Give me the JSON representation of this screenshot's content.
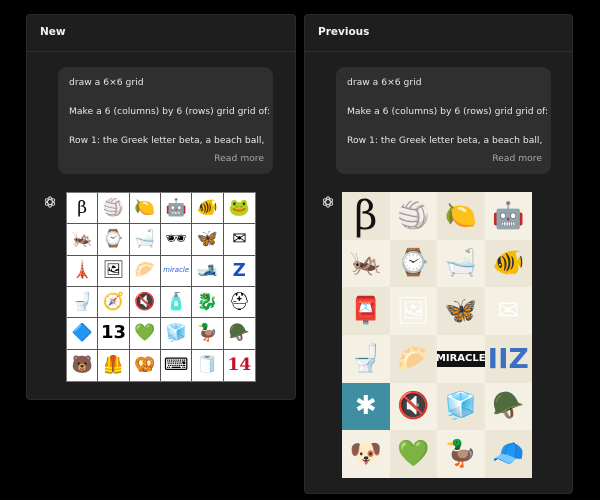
{
  "panels": {
    "new": {
      "title": "New",
      "prompt": {
        "line1": "draw a 6×6 grid",
        "line2": "Make a 6 (columns) by 6 (rows) grid grid of:",
        "line3": "Row 1: the Greek letter beta, a beach ball, a...",
        "read_more": "Read more"
      },
      "grid": [
        [
          "β",
          "🏐",
          "🍋",
          "🤖",
          "🐠",
          "🐸"
        ],
        [
          "🦗",
          "⌚",
          "🛁",
          "🕶",
          "🦋",
          "✉"
        ],
        [
          "🗼",
          "🖼",
          "🥟",
          "miracle",
          "🎿",
          "Z"
        ],
        [
          "🚽",
          "🧭",
          "🔇",
          "🧴",
          "🐉",
          "⛑"
        ],
        [
          "🔷",
          "13",
          "💚",
          "🧊",
          "🦆",
          "🪖"
        ],
        [
          "🐻",
          "🦺",
          "🥨",
          "⌨",
          "🧻",
          "14"
        ]
      ]
    },
    "previous": {
      "title": "Previous",
      "prompt": {
        "line1": "draw a 6×6 grid",
        "line2": "Make a 6 (columns) by 6 (rows) grid grid of:",
        "line3": "Row 1: the Greek letter beta, a beach ball, a...",
        "read_more": "Read more"
      },
      "grid": [
        [
          "β",
          "🏐",
          "🍋",
          "🤖"
        ],
        [
          "🦗",
          "⌚",
          "🛁",
          "🐠"
        ],
        [
          "📮",
          "🖼",
          "🦋",
          "✉"
        ],
        [
          "🚽",
          "🥟",
          "MIRACLE",
          "IIZ"
        ],
        [
          "✱",
          "🔇",
          "🧊",
          "🪖"
        ],
        [
          "🐶",
          "💚",
          "🦆",
          "🧢"
        ]
      ]
    }
  },
  "colors": {
    "background": "#000000",
    "panel": "#1e1e1e",
    "bubble": "#2f2f2f",
    "muted_text": "#a8a8a8"
  },
  "icons": {
    "assistant_avatar": "openai-logo-icon"
  }
}
